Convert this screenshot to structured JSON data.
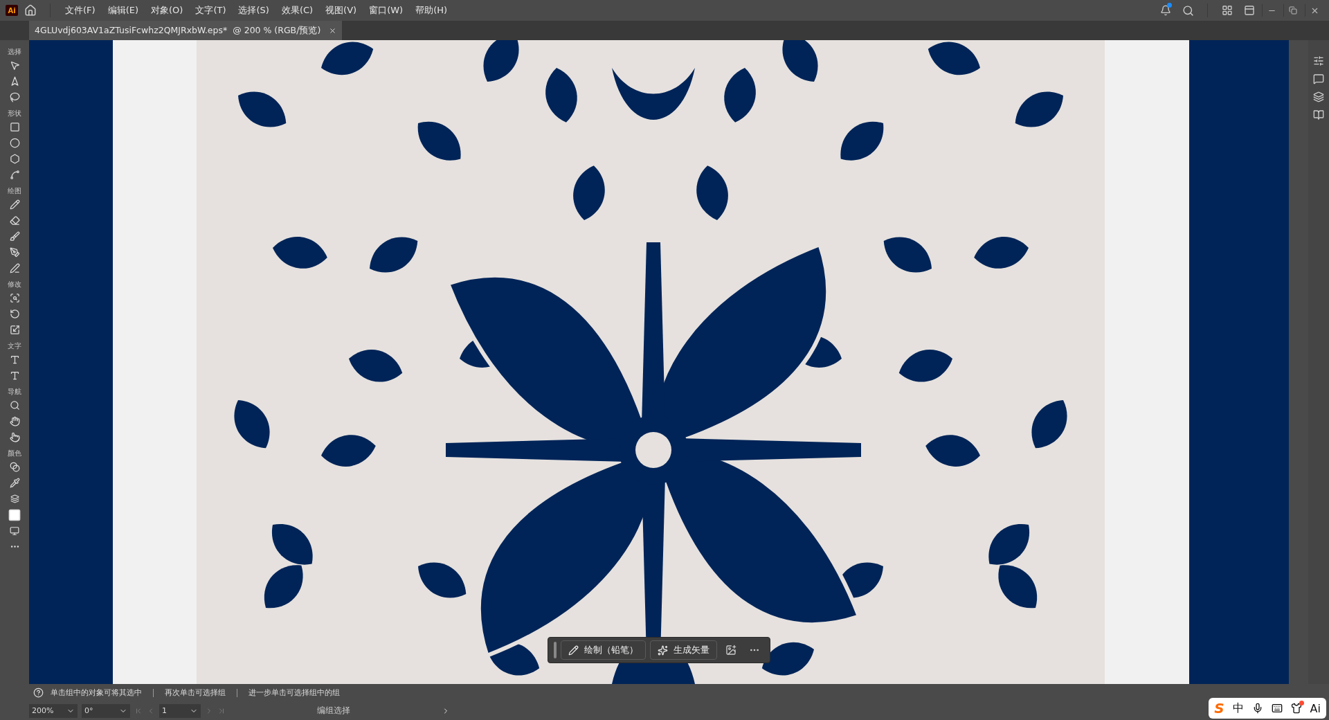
{
  "app": {
    "logo": "Ai",
    "has_notification": true
  },
  "menu": [
    "文件(F)",
    "编辑(E)",
    "对象(O)",
    "文字(T)",
    "选择(S)",
    "效果(C)",
    "视图(V)",
    "窗口(W)",
    "帮助(H)"
  ],
  "document_tab": {
    "title": "4GLUvdj603AV1aZTusiFcwhz2QMJRxbW.eps*  @ 200 % (RGB/预览)",
    "selected": true
  },
  "toolbar_groups": [
    {
      "label": "选择"
    },
    {
      "label": "形状"
    },
    {
      "label": "绘图"
    },
    {
      "label": "修改"
    },
    {
      "label": "文字"
    },
    {
      "label": "导航"
    },
    {
      "label": "颜色"
    }
  ],
  "context_toolbar": {
    "buttons": [
      {
        "kind": "pencil",
        "label": "绘制（铅笔）"
      },
      {
        "kind": "vector",
        "label": "生成矢量"
      }
    ]
  },
  "status_hints": [
    "单击组中的对象可将其选中",
    "再次单击可选择组",
    "进一步单击可选择组中的组"
  ],
  "status_bar": {
    "zoom": "200%",
    "rotation": "0°",
    "artboard": "1",
    "tool": "编组选择"
  },
  "ime": {
    "logo": "S",
    "mode": "中",
    "ai": "Ai",
    "has_badge": true
  }
}
